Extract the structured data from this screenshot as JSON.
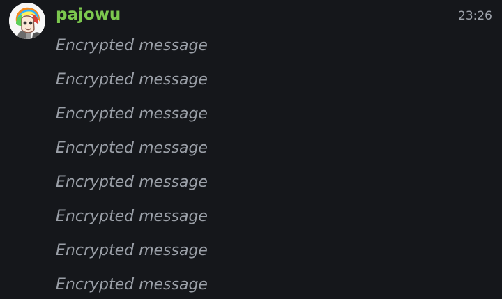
{
  "message_group": {
    "sender": "pajowu",
    "timestamp": "23:26",
    "avatar_icon": "user-avatar-icon",
    "messages": [
      "Encrypted message",
      "Encrypted message",
      "Encrypted message",
      "Encrypted message",
      "Encrypted message",
      "Encrypted message",
      "Encrypted message",
      "Encrypted message"
    ]
  },
  "colors": {
    "background": "#15171b",
    "sender_name": "#7cc84f",
    "message_text": "#9ba0a8",
    "timestamp": "#9ea3ab"
  }
}
